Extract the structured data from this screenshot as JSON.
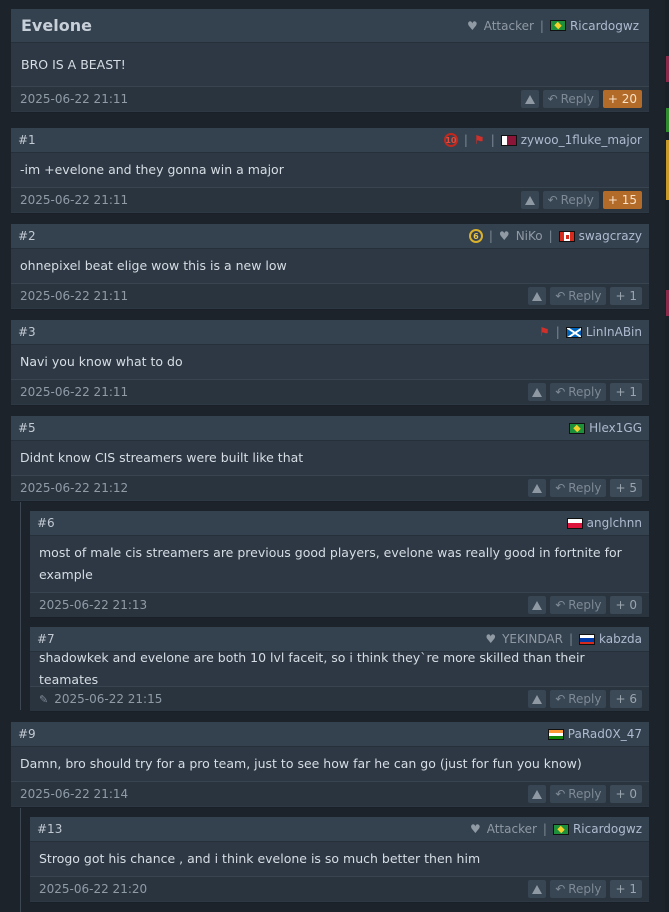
{
  "thread": {
    "title": "Evelone",
    "op": {
      "role": "Attacker",
      "user": "Ricardogwz",
      "text": "BRO IS A BEAST!",
      "time": "2025-06-22 21:11",
      "votes": "+ 20"
    }
  },
  "reply_label": "Reply",
  "comments": [
    {
      "num": "#1",
      "user": "zywoo_1fluke_major",
      "text": "-im +evelone and they gonna win a major",
      "time": "2025-06-22 21:11",
      "votes": "+ 15",
      "level_badge": "10"
    },
    {
      "num": "#2",
      "user": "swagcrazy",
      "fav": "NiKo",
      "text": "ohnepixel beat elige wow this is a new low",
      "time": "2025-06-22 21:11",
      "votes": "+ 1",
      "level_badge": "6"
    },
    {
      "num": "#3",
      "user": "LinInABin",
      "text": "Navi you know what to do",
      "time": "2025-06-22 21:11",
      "votes": "+ 1"
    },
    {
      "num": "#5",
      "user": "Hlex1GG",
      "text": "Didnt know CIS streamers were built like that",
      "time": "2025-06-22 21:12",
      "votes": "+ 5"
    },
    {
      "num": "#6",
      "user": "anglchnn",
      "text": "most of male cis streamers are previous good players, evelone was really good in fortnite for example",
      "time": "2025-06-22 21:13",
      "votes": "+ 0"
    },
    {
      "num": "#7",
      "user": "kabzda",
      "fav": "YEKINDAR",
      "text": "shadowkek and evelone are both 10 lvl faceit, so i think they`re more skilled than their teamates",
      "time": "2025-06-22 21:15",
      "votes": "+ 6"
    },
    {
      "num": "#9",
      "user": "PaRad0X_47",
      "text": "Damn, bro should try for a pro team, just to see how far he can go (just for fun you know)",
      "time": "2025-06-22 21:14",
      "votes": "+ 0"
    },
    {
      "num": "#13",
      "user": "Ricardogwz",
      "fav": "Attacker",
      "text": "Strogo got his chance , and i think evelone is so much better then him",
      "time": "2025-06-22 21:20",
      "votes": "+ 1"
    }
  ],
  "colors": {
    "hot_vote": "#b36b2a",
    "background": "#1c232b",
    "post": "#2d3844"
  }
}
